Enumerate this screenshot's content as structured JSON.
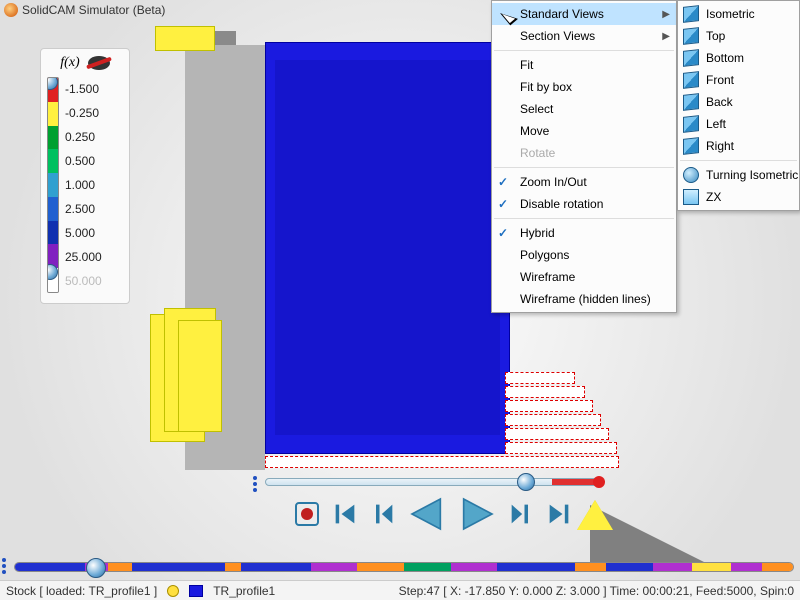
{
  "app": {
    "title": "SolidCAM Simulator (Beta)"
  },
  "legend": {
    "fx": "f(x)",
    "values": [
      "-1.500",
      "-0.250",
      "0.250",
      "0.500",
      "1.000",
      "2.500",
      "5.000",
      "25.000",
      "50.000"
    ],
    "colors": [
      "#e02020",
      "#fff040",
      "#00a030",
      "#00c060",
      "#30a0d0",
      "#2060d0",
      "#1030b0",
      "#8020c0",
      "#ffffff"
    ],
    "dim_last": true
  },
  "playback": {
    "progress_pct": 78,
    "red_tail_pct": 14,
    "controls": [
      "record",
      "first",
      "prev",
      "play-back",
      "play-fwd",
      "next",
      "last"
    ]
  },
  "timeline": {
    "segments": [
      {
        "c": "#2030d0",
        "w": 9
      },
      {
        "c": "#b030d0",
        "w": 3
      },
      {
        "c": "#ff9020",
        "w": 3
      },
      {
        "c": "#2030d0",
        "w": 12
      },
      {
        "c": "#ff9020",
        "w": 2
      },
      {
        "c": "#2030d0",
        "w": 9
      },
      {
        "c": "#b030d0",
        "w": 6
      },
      {
        "c": "#ff9020",
        "w": 6
      },
      {
        "c": "#00a060",
        "w": 6
      },
      {
        "c": "#b030d0",
        "w": 6
      },
      {
        "c": "#2030d0",
        "w": 10
      },
      {
        "c": "#ff9020",
        "w": 4
      },
      {
        "c": "#2030d0",
        "w": 6
      },
      {
        "c": "#b030d0",
        "w": 5
      },
      {
        "c": "#ffe040",
        "w": 5
      },
      {
        "c": "#b030d0",
        "w": 4
      },
      {
        "c": "#ff9020",
        "w": 4
      }
    ],
    "knob_pct": 10.5
  },
  "status": {
    "stock": "Stock [ loaded:  TR_profile1 ]",
    "op": "TR_profile1",
    "info": "Step:47 [ X: -17.850 Y: 0.000 Z: 3.000 ] Time: 00:00:21, Feed:5000, Spin:0"
  },
  "context_menu": {
    "items": [
      {
        "label": "Standard Views",
        "submenu": true,
        "highlight": true
      },
      {
        "label": "Section Views",
        "submenu": true
      },
      {
        "sep": true
      },
      {
        "label": "Fit"
      },
      {
        "label": "Fit by box"
      },
      {
        "label": "Select"
      },
      {
        "label": "Move"
      },
      {
        "label": "Rotate",
        "disabled": true
      },
      {
        "sep": true
      },
      {
        "label": "Zoom In/Out",
        "checked": true
      },
      {
        "label": "Disable rotation",
        "checked": true
      },
      {
        "sep": true
      },
      {
        "label": "Hybrid",
        "checked": true
      },
      {
        "label": "Polygons"
      },
      {
        "label": "Wireframe"
      },
      {
        "label": "Wireframe (hidden lines)"
      }
    ]
  },
  "submenu_views": {
    "items": [
      {
        "label": "Isometric",
        "icon": "cube"
      },
      {
        "label": "Top",
        "icon": "cube"
      },
      {
        "label": "Bottom",
        "icon": "cube"
      },
      {
        "label": "Front",
        "icon": "cube"
      },
      {
        "label": "Back",
        "icon": "cube"
      },
      {
        "label": "Left",
        "icon": "cube"
      },
      {
        "label": "Right",
        "icon": "cube"
      },
      {
        "sep": true
      },
      {
        "label": "Turning Isometric",
        "icon": "globe"
      },
      {
        "label": "ZX",
        "icon": "plane"
      }
    ]
  }
}
